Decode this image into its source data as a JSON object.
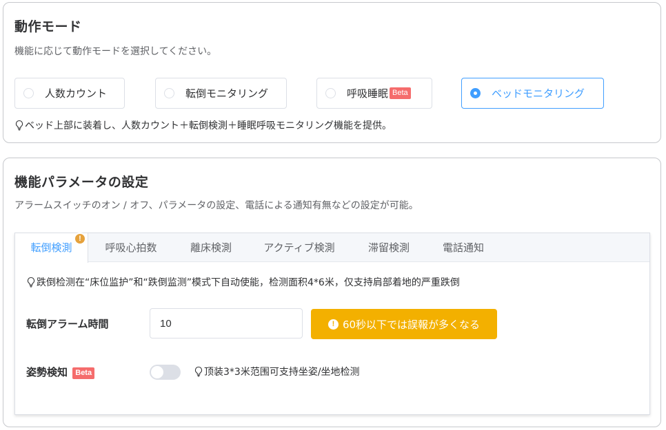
{
  "mode_section": {
    "title": "動作モード",
    "description": "機能に応じて動作モードを選択してください。",
    "options": [
      {
        "label": "人数カウント",
        "selected": false
      },
      {
        "label": "転倒モニタリング",
        "selected": false
      },
      {
        "label": "呼吸睡眠",
        "badge": "Beta",
        "selected": false
      },
      {
        "label": "ベッドモニタリング",
        "selected": true
      }
    ],
    "hint": "ベッド上部に装着し、人数カウント＋転倒検測＋睡眠呼吸モニタリング機能を提供。"
  },
  "params_section": {
    "title": "機能パラメータの設定",
    "description": "アラームスイッチのオン / オフ、パラメータの設定、電話による通知有無などの設定が可能。",
    "tabs": [
      {
        "label": "転倒検測",
        "active": true,
        "warning": "!"
      },
      {
        "label": "呼吸心拍数"
      },
      {
        "label": "離床検測"
      },
      {
        "label": "アクティブ検測"
      },
      {
        "label": "滞留検測"
      },
      {
        "label": "電話通知"
      }
    ],
    "tab_hint": "跌倒检测在“床位监护”和“跌倒监测”模式下自动使能，检测面积4*6米，仅支持肩部着地的严重跌倒",
    "alarm_time": {
      "label": "転倒アラーム時間",
      "value": "10",
      "warning_button": "60秒以下では誤報が多くなる",
      "warning_icon": "!"
    },
    "posture": {
      "label": "姿勢検知",
      "badge": "Beta",
      "enabled": false,
      "hint": "顶装3*3米范围可支持坐姿/坐地检测"
    }
  },
  "colors": {
    "accent": "#409eff",
    "warning": "#f3b000",
    "badge": "#f56c6c"
  }
}
